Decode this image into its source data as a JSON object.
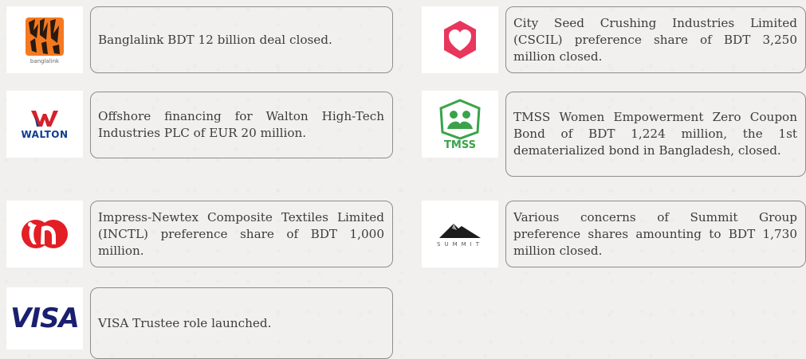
{
  "deals": [
    {
      "logo": {
        "name": "banglalink-logo",
        "text": "banglalink",
        "accent": "#f47920"
      },
      "description": "Banglalink BDT 12 billion deal closed."
    },
    {
      "logo": {
        "name": "cscil-heart-logo",
        "accent": "#e8365c"
      },
      "description": "City Seed Crushing Industries Limited (CSCIL) preference share of BDT 3,250 million closed."
    },
    {
      "logo": {
        "name": "walton-logo",
        "text": "WALTON",
        "accent": "#0d3d91"
      },
      "description": "Offshore financing for Walton High-Tech Industries PLC of EUR 20 million."
    },
    {
      "logo": {
        "name": "tmss-logo",
        "text": "TMSS",
        "accent": "#3aa34a"
      },
      "description": "TMSS Women Empowerment Zero Coupon Bond of BDT 1,224 million, the 1st dematerialized bond in Bangladesh, closed."
    },
    {
      "logo": {
        "name": "impress-newtex-logo",
        "accent": "#e31e24"
      },
      "description": "Impress-Newtex Composite Textiles Limited (INCTL) preference share of BDT 1,000 million."
    },
    {
      "logo": {
        "name": "summit-logo",
        "text": "SUMMIT",
        "accent": "#1c1c1c"
      },
      "description": "Various concerns of Summit Group preference shares amounting to BDT 1,730 million closed."
    },
    {
      "logo": {
        "name": "visa-logo",
        "text": "VISA",
        "accent": "#1a1f71"
      },
      "description": "VISA Trustee role launched."
    }
  ]
}
